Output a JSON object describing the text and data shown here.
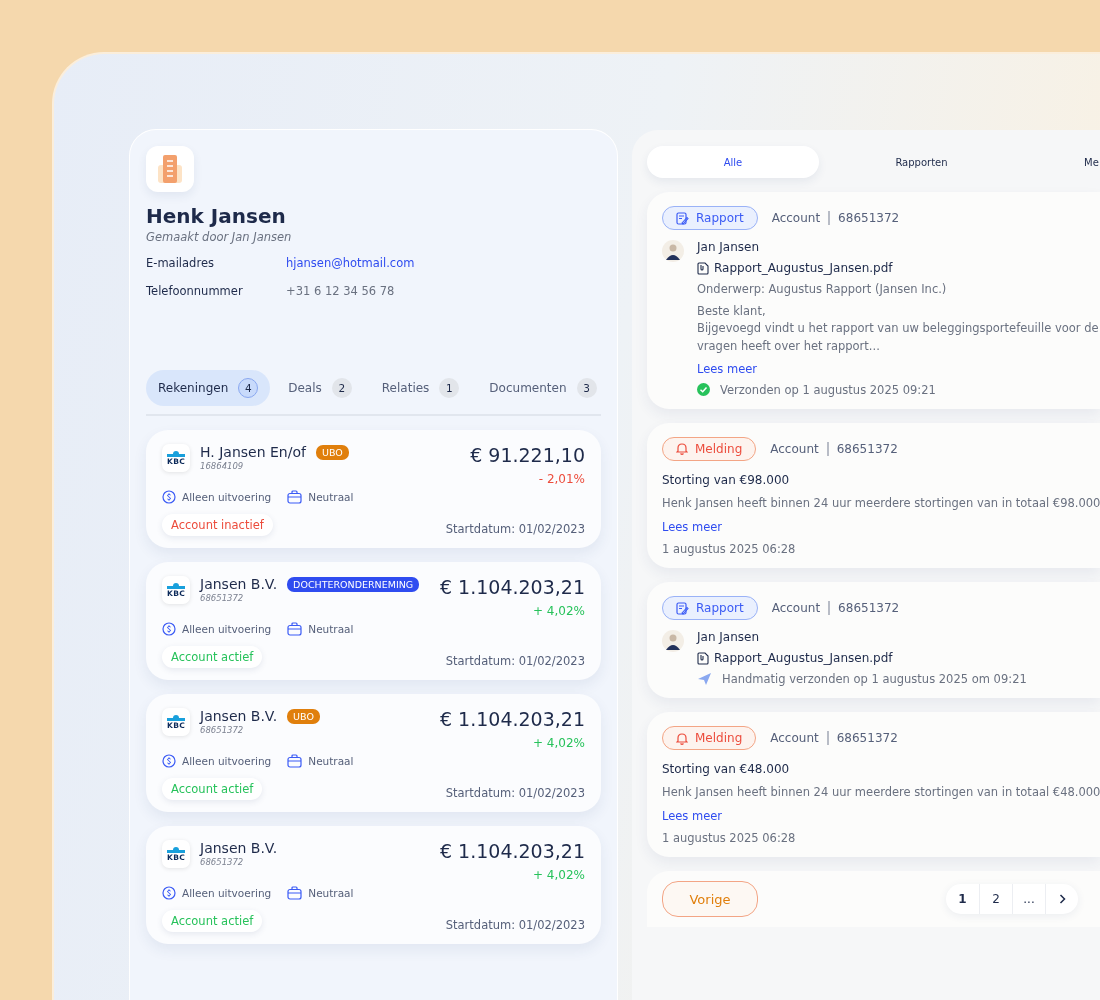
{
  "client": {
    "name": "Henk Jansen",
    "created_by": "Gemaakt door Jan Jansen",
    "fields": [
      {
        "label": "E-mailadres",
        "value": "hjansen@hotmail.com",
        "kind": "link"
      },
      {
        "label": "Telefoonnummer",
        "value": "+31 6 12 34 56 78",
        "kind": "text"
      }
    ]
  },
  "tabs": [
    {
      "label": "Rekeningen",
      "count": "4",
      "selected": true
    },
    {
      "label": "Deals",
      "count": "2",
      "selected": false
    },
    {
      "label": "Relaties",
      "count": "1",
      "selected": false
    },
    {
      "label": "Documenten",
      "count": "3",
      "selected": false
    }
  ],
  "accounts": [
    {
      "logo_text": "KBC",
      "name": "H. Jansen En/of",
      "number": "16864109",
      "tag": {
        "label": "UBO",
        "color": "#e07f0c"
      },
      "amount": "€ 91.221,10",
      "change": "- 2,01%",
      "rising": false,
      "service": "Alleen uitvoering",
      "profile": "Neutraal",
      "status": "Account inactief",
      "active": false,
      "start": "Startdatum: 01/02/2023"
    },
    {
      "logo_text": "KBC",
      "name": "Jansen B.V.",
      "number": "68651372",
      "tag": {
        "label": "DOCHTERONDERNEMING",
        "color": "#2f4cf0"
      },
      "amount": "€ 1.104.203,21",
      "change": "+ 4,02%",
      "rising": true,
      "service": "Alleen uitvoering",
      "profile": "Neutraal",
      "status": "Account actief",
      "active": true,
      "start": "Startdatum: 01/02/2023"
    },
    {
      "logo_text": "KBC",
      "name": "Jansen B.V.",
      "number": "68651372",
      "tag": {
        "label": "UBO",
        "color": "#e07f0c"
      },
      "amount": "€ 1.104.203,21",
      "change": "+ 4,02%",
      "rising": true,
      "service": "Alleen uitvoering",
      "profile": "Neutraal",
      "status": "Account actief",
      "active": true,
      "start": "Startdatum: 01/02/2023"
    },
    {
      "logo_text": "KBC",
      "name": "Jansen B.V.",
      "number": "68651372",
      "amount": "€ 1.104.203,21",
      "change": "+ 4,02%",
      "rising": true,
      "service": "Alleen uitvoering",
      "profile": "Neutraal",
      "status": "Account actief",
      "active": true,
      "start": "Startdatum: 01/02/2023"
    }
  ],
  "feed_tabs": [
    {
      "label": "Alle",
      "selected": true
    },
    {
      "label": "Rapporten",
      "selected": false
    },
    {
      "label": "Me",
      "selected": false
    }
  ],
  "feed": [
    {
      "kind": "rapport",
      "badge": "Rapport",
      "account_label": "Account",
      "account_number": "68651372",
      "author": "Jan Jansen",
      "attachment": "Rapport_Augustus_Jansen.pdf",
      "subject": "Onderwerp: Augustus Rapport (Jansen Inc.)",
      "body": [
        "Beste klant,",
        "Bijgevoegd vindt u het rapport van uw beleggingsportefeuille voor de",
        "vragen heeft over het rapport..."
      ],
      "link": "Lees meer",
      "sent": {
        "kind": "delivered",
        "text": "Verzonden op 1 augustus 2025 09:21"
      }
    },
    {
      "kind": "melding",
      "badge": "Melding",
      "account_label": "Account",
      "account_number": "68651372",
      "title": "Storting van €98.000",
      "body": [
        "Henk Jansen heeft binnen 24 uur meerdere stortingen van in totaal €98.000"
      ],
      "link": "Lees meer",
      "date": "1 augustus 2025 06:28"
    },
    {
      "kind": "rapport",
      "badge": "Rapport",
      "account_label": "Account",
      "account_number": "68651372",
      "author": "Jan Jansen",
      "attachment": "Rapport_Augustus_Jansen.pdf",
      "sent": {
        "kind": "manual",
        "text": "Handmatig verzonden op 1 augustus 2025 om 09:21"
      }
    },
    {
      "kind": "melding",
      "badge": "Melding",
      "account_label": "Account",
      "account_number": "68651372",
      "title": "Storting van €48.000",
      "body": [
        "Henk Jansen heeft binnen 24 uur meerdere stortingen van in totaal €48.000"
      ],
      "link": "Lees meer",
      "date": "1 augustus 2025 06:28"
    }
  ],
  "pagination": {
    "previous": "Vorige",
    "pages": [
      {
        "label": "1",
        "selected": true
      },
      {
        "label": "2",
        "selected": false
      },
      {
        "label": "...",
        "selected": false
      }
    ]
  }
}
